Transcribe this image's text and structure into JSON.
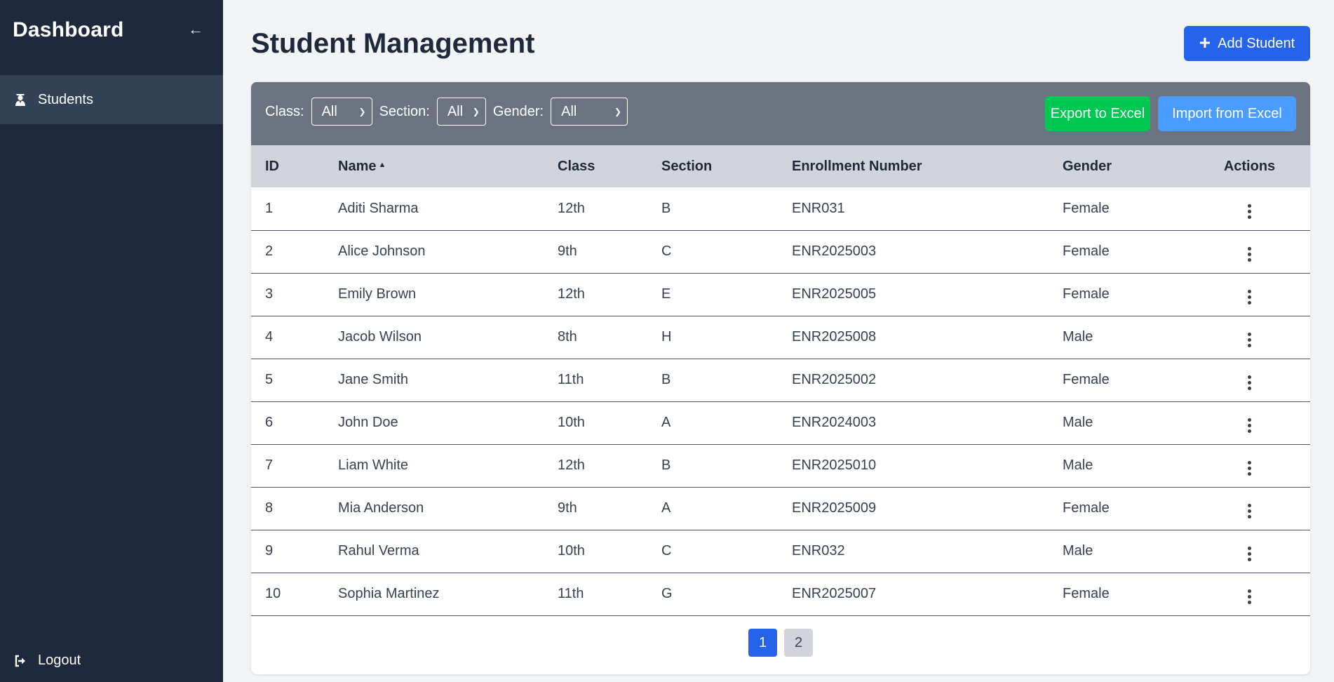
{
  "sidebar": {
    "title": "Dashboard",
    "collapse_icon": "arrow-left-icon",
    "items": [
      {
        "label": "Students",
        "icon": "student-icon"
      }
    ],
    "logout_label": "Logout"
  },
  "main": {
    "title": "Student Management",
    "add_button_label": "Add Student"
  },
  "filters": {
    "class_label": "Class:",
    "class_value": "All",
    "section_label": "Section:",
    "section_value": "All",
    "gender_label": "Gender:",
    "gender_value": "All"
  },
  "actions": {
    "export_label": "Export to Excel",
    "import_label": "Import from Excel"
  },
  "table": {
    "columns": [
      "ID",
      "Name",
      "Class",
      "Section",
      "Enrollment Number",
      "Gender",
      "Actions"
    ],
    "rows": [
      [
        "1",
        "Aditi Sharma",
        "12th",
        "B",
        "ENR031",
        "Female"
      ],
      [
        "2",
        "Alice Johnson",
        "9th",
        "C",
        "ENR2025003",
        "Female"
      ],
      [
        "3",
        "Emily Brown",
        "12th",
        "E",
        "ENR2025005",
        "Female"
      ],
      [
        "4",
        "Jacob Wilson",
        "8th",
        "H",
        "ENR2025008",
        "Male"
      ],
      [
        "5",
        "Jane Smith",
        "11th",
        "B",
        "ENR2025002",
        "Female"
      ],
      [
        "6",
        "John Doe",
        "10th",
        "A",
        "ENR2024003",
        "Male"
      ],
      [
        "7",
        "Liam White",
        "12th",
        "B",
        "ENR2025010",
        "Male"
      ],
      [
        "8",
        "Mia Anderson",
        "9th",
        "A",
        "ENR2025009",
        "Female"
      ],
      [
        "9",
        "Rahul Verma",
        "10th",
        "C",
        "ENR032",
        "Male"
      ],
      [
        "10",
        "Sophia Martinez",
        "11th",
        "G",
        "ENR2025007",
        "Female"
      ]
    ]
  },
  "pagination": {
    "pages": [
      "1",
      "2"
    ],
    "current": "1"
  },
  "colors": {
    "sidebar_bg": "#1e293b",
    "primary": "#2563eb",
    "export_green": "#00c853",
    "import_blue": "#4b9cff"
  }
}
